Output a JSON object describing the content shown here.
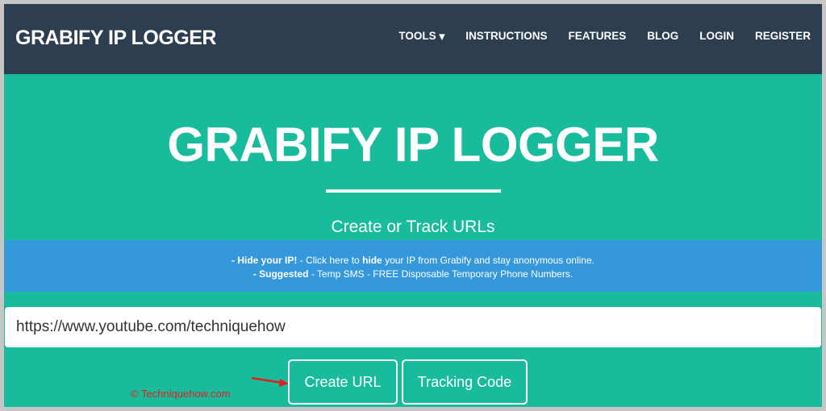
{
  "nav": {
    "brand": "GRABIFY IP LOGGER",
    "items": [
      {
        "label": "TOOLS"
      },
      {
        "label": "INSTRUCTIONS"
      },
      {
        "label": "FEATURES"
      },
      {
        "label": "BLOG"
      },
      {
        "label": "LOGIN"
      },
      {
        "label": "REGISTER"
      }
    ],
    "tools_caret": "▾"
  },
  "hero": {
    "title": "GRABIFY IP LOGGER",
    "subtitle": "Create or Track URLs"
  },
  "banner": {
    "line1_bold": "- Hide your IP!",
    "line1_a": " - Click here to ",
    "line1_bold2": "hide",
    "line1_b": " your IP from Grabify and stay anonymous online.",
    "line2_bold": "- Suggested",
    "line2": " - Temp SMS - FREE Disposable Temporary Phone Numbers."
  },
  "form": {
    "url_value": "https://www.youtube.com/techniquehow",
    "create_label": "Create URL",
    "tracking_label": "Tracking Code"
  },
  "watermark": "© Techniquehow.com",
  "colors": {
    "navbar": "#2c3e50",
    "hero": "#18bc9c",
    "banner": "#3498db",
    "annotation": "#e02020"
  }
}
